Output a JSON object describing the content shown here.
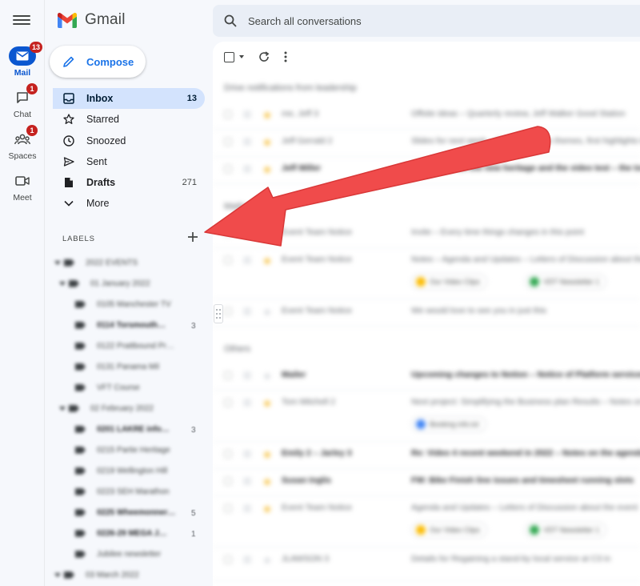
{
  "rail": {
    "items": [
      {
        "label": "Mail",
        "badge": "13",
        "icon": "mail-icon",
        "active": true
      },
      {
        "label": "Chat",
        "badge": "1",
        "icon": "chat-icon"
      },
      {
        "label": "Spaces",
        "badge": "1",
        "icon": "spaces-icon"
      },
      {
        "label": "Meet",
        "badge": "",
        "icon": "meet-icon"
      }
    ]
  },
  "app": {
    "name": "Gmail"
  },
  "compose": {
    "label": "Compose"
  },
  "nav": {
    "items": [
      {
        "label": "Inbox",
        "count": "13",
        "icon": "inbox-icon",
        "active": true
      },
      {
        "label": "Starred",
        "count": "",
        "icon": "star-icon"
      },
      {
        "label": "Snoozed",
        "count": "",
        "icon": "clock-icon"
      },
      {
        "label": "Sent",
        "count": "",
        "icon": "send-icon"
      },
      {
        "label": "Drafts",
        "count": "271",
        "icon": "draft-icon",
        "bold": true
      },
      {
        "label": "More",
        "count": "",
        "icon": "chevron-down-icon"
      }
    ]
  },
  "labels": {
    "heading": "LABELS",
    "items": [
      {
        "text": "2022 EVENTS",
        "count": ""
      },
      {
        "text": "01 January 2022",
        "count": ""
      },
      {
        "text": "0105 Manchester TV",
        "count": ""
      },
      {
        "text": "0114 Torsmouth…",
        "count": "3"
      },
      {
        "text": "0122 Prattbound Pr…",
        "count": ""
      },
      {
        "text": "0131 Panama Mil",
        "count": ""
      },
      {
        "text": "VFT Course",
        "count": ""
      },
      {
        "text": "02 February 2022",
        "count": ""
      },
      {
        "text": "0201 LAKRE info…",
        "count": "3"
      },
      {
        "text": "0215 Partie Heritage",
        "count": ""
      },
      {
        "text": "0219 Wellington Hill",
        "count": ""
      },
      {
        "text": "0223 SEH Marathon",
        "count": ""
      },
      {
        "text": "0225 Wheemonner…",
        "count": "5"
      },
      {
        "text": "0226-29 MEGA J…",
        "count": "1"
      },
      {
        "text": "Jubilee newsletter",
        "count": ""
      },
      {
        "text": "03 March 2022",
        "count": ""
      }
    ]
  },
  "search": {
    "placeholder": "Search all conversations"
  },
  "mail": {
    "section1": "Drive notifications from leadership",
    "section2": "Mailing list",
    "section3": "Others",
    "rows": [
      {
        "sender": "me, Jeff 3",
        "subject": "Offsite ideas – Quarterly review, Jeff Walker Good Station"
      },
      {
        "sender": "Jeff Gerrald 2",
        "subject": "Slides for next week – Some notes on themes, first highlights to"
      },
      {
        "sender": "Jeff Miller",
        "subject": "Quick note on the new heritage and the video test – the tour"
      },
      {
        "sender": "Event Team Notice",
        "subject": "Invite – Every time things changes in this point"
      },
      {
        "sender": "Event Team Notice",
        "subject": "Notes – Agenda and Updates – Letters of Discussion about the"
      },
      {
        "sender": "Event Team Notice",
        "subject": "We would love to see you in just this"
      },
      {
        "sender": "Mailer",
        "subject": "Upcoming changes to Notion – Notice of Platform services"
      },
      {
        "sender": "Tom Mitchell 2",
        "subject": "Next project: Simplifying the Business plan Results – Notes on the"
      },
      {
        "sender": "Emily 2 – Jarley 3",
        "subject": "Re: Video 4 recent weekend in 2022 – Notes on the agenda"
      },
      {
        "sender": "Susan Inglis",
        "subject": "FW: Bike Finish line issues and timesheet running slots"
      },
      {
        "sender": "Event Team Notice",
        "subject": "Agenda and Updates – Letters of Discussion about the event"
      },
      {
        "sender": "JLAWSON 3",
        "subject": "Details for Regaining a stand-by local service at C3 in"
      }
    ],
    "chips": [
      "Our Video Clips",
      "VDT Newsletter 1",
      "Booking info.txt"
    ]
  },
  "colors": {
    "accent": "#0b57d0",
    "badge": "#c5221f",
    "arrow": "#f04b4b"
  }
}
